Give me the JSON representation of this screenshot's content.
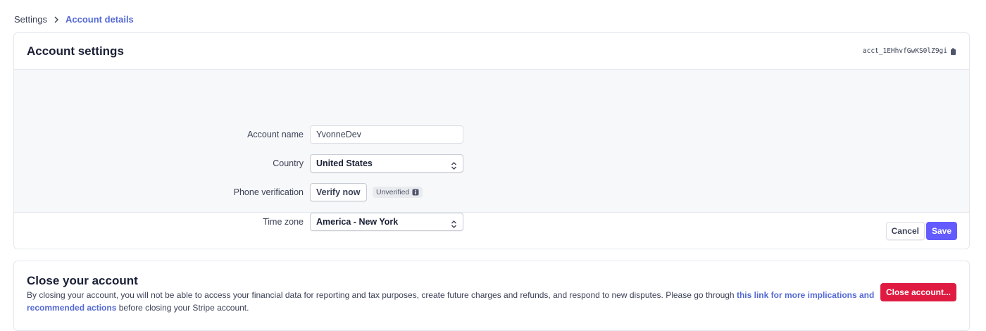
{
  "breadcrumb": {
    "parent": "Settings",
    "current": "Account details"
  },
  "account_settings": {
    "title": "Account settings",
    "account_id": "acct_1EHhvfGwKS0lZ9gi",
    "fields": {
      "account_name": {
        "label": "Account name",
        "value": "YvonneDev"
      },
      "country": {
        "label": "Country",
        "value": "United States"
      },
      "phone_verification": {
        "label": "Phone verification",
        "button": "Verify now",
        "status": "Unverified"
      },
      "time_zone": {
        "label": "Time zone",
        "value": "America - New York"
      }
    },
    "cancel_label": "Cancel",
    "save_label": "Save"
  },
  "close_account": {
    "title": "Close your account",
    "description_before": "By closing your account, you will not be able to access your financial data for reporting and tax purposes, create future charges and refunds, and respond to new disputes. Please go through ",
    "link_text": "this link for more implications and recommended actions",
    "description_after": " before closing your Stripe account.",
    "button_label": "Close account..."
  },
  "colors": {
    "primary": "#635bff",
    "link": "#5469d4",
    "danger": "#df1b41"
  },
  "icons": [
    "chevron-right-icon",
    "copy-icon",
    "select-arrows-icon",
    "info-icon"
  ]
}
